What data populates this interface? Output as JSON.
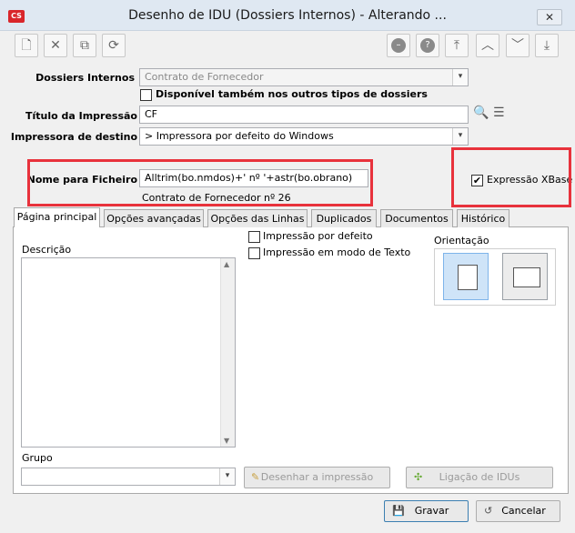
{
  "window": {
    "title": "Desenho de IDU (Dossiers Internos) - Alterando ...",
    "close_glyph": "✕",
    "app_icon_text": "CS"
  },
  "toolbar": {
    "left_icons": [
      "new-icon",
      "delete-icon",
      "copy-icon",
      "refresh-icon"
    ],
    "right_icons": [
      "stop-icon",
      "help-icon",
      "first-icon",
      "previous-icon",
      "next-icon",
      "last-icon"
    ]
  },
  "form": {
    "dossiers_label": "Dossiers Internos",
    "dossiers_value": "Contrato de Fornecedor",
    "disponivel_label": "Disponível também nos outros tipos de dossiers",
    "disponivel_checked": false,
    "titulo_label": "Título da Impressão",
    "titulo_value": "CF",
    "impressora_label": "Impressora de destino",
    "impressora_value": "> Impressora por defeito do Windows",
    "nome_label": "Nome para Ficheiro",
    "nome_value": "Alltrim(bo.nmdos)+' nº '+astr(bo.obrano)",
    "nome_preview": "Contrato de Fornecedor nº 26",
    "xbase_label": "Expressão XBase",
    "xbase_checked": true
  },
  "tabs": [
    {
      "label": "Página principal",
      "active": true
    },
    {
      "label": "Opções avançadas",
      "active": false
    },
    {
      "label": "Opções das Linhas",
      "active": false
    },
    {
      "label": "Duplicados",
      "active": false
    },
    {
      "label": "Documentos",
      "active": false
    },
    {
      "label": "Histórico",
      "active": false
    }
  ],
  "main": {
    "descricao_label": "Descrição",
    "impressao_defeito_label": "Impressão por defeito",
    "impressao_texto_label": "Impressão em modo de Texto",
    "orientacao_label": "Orientação",
    "grupo_label": "Grupo",
    "grupo_value": "",
    "desenhar_label": "Desenhar a impressão",
    "ligacao_label": "Ligação de IDUs"
  },
  "footer": {
    "gravar_label": "Gravar",
    "cancelar_label": "Cancelar"
  },
  "colors": {
    "highlight": "#e8323c",
    "accent": "#cfe4f8"
  }
}
